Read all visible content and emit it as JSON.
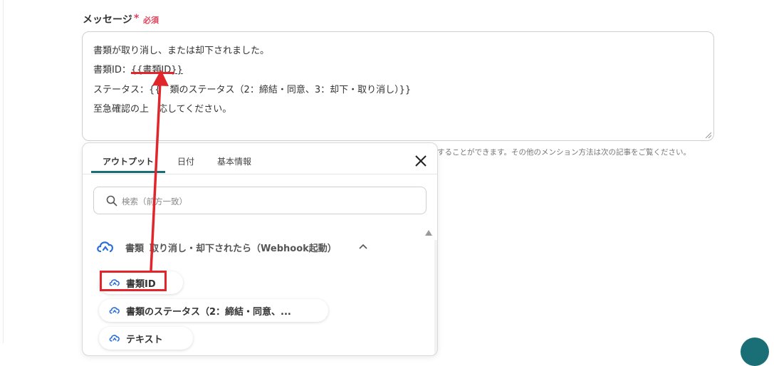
{
  "form": {
    "label": "メッセージ",
    "required_star": "*",
    "required_text": "必須"
  },
  "message": {
    "line1": "書類が取り消し、または却下されました。",
    "line2_prefix": "書類ID：",
    "line2_token": "{{書類ID}}",
    "line3_prefix": "ステータス：{{",
    "line3_rest": "類のステータス（2：締結・同意、3：却下・取り消し）}}",
    "line4_prefix": "至急確認の上",
    "line4_rest": "応してください。"
  },
  "hint_text": "することができます。その他のメンション方法は次の記事をご覧ください。",
  "popup": {
    "tabs": [
      "アウトプット",
      "日付",
      "基本情報"
    ],
    "active_tab": "アウトプット",
    "search_placeholder": "検索（前方一致）",
    "group_title_a": "書類",
    "group_title_b": "取り消し・却下されたら（Webhook起動）",
    "items": [
      "書類ID",
      "書類のステータス（2：締結・同意、...",
      "テキスト"
    ]
  },
  "colors": {
    "accent": "#1a6e75",
    "required": "#e0405a",
    "annotation": "#e0262b",
    "icon_blue": "#2b6fd6"
  },
  "icons": {
    "close": "close-icon",
    "search": "search-icon",
    "trigger": "cloud-webhook-icon",
    "chevron": "chevron-up-icon"
  }
}
